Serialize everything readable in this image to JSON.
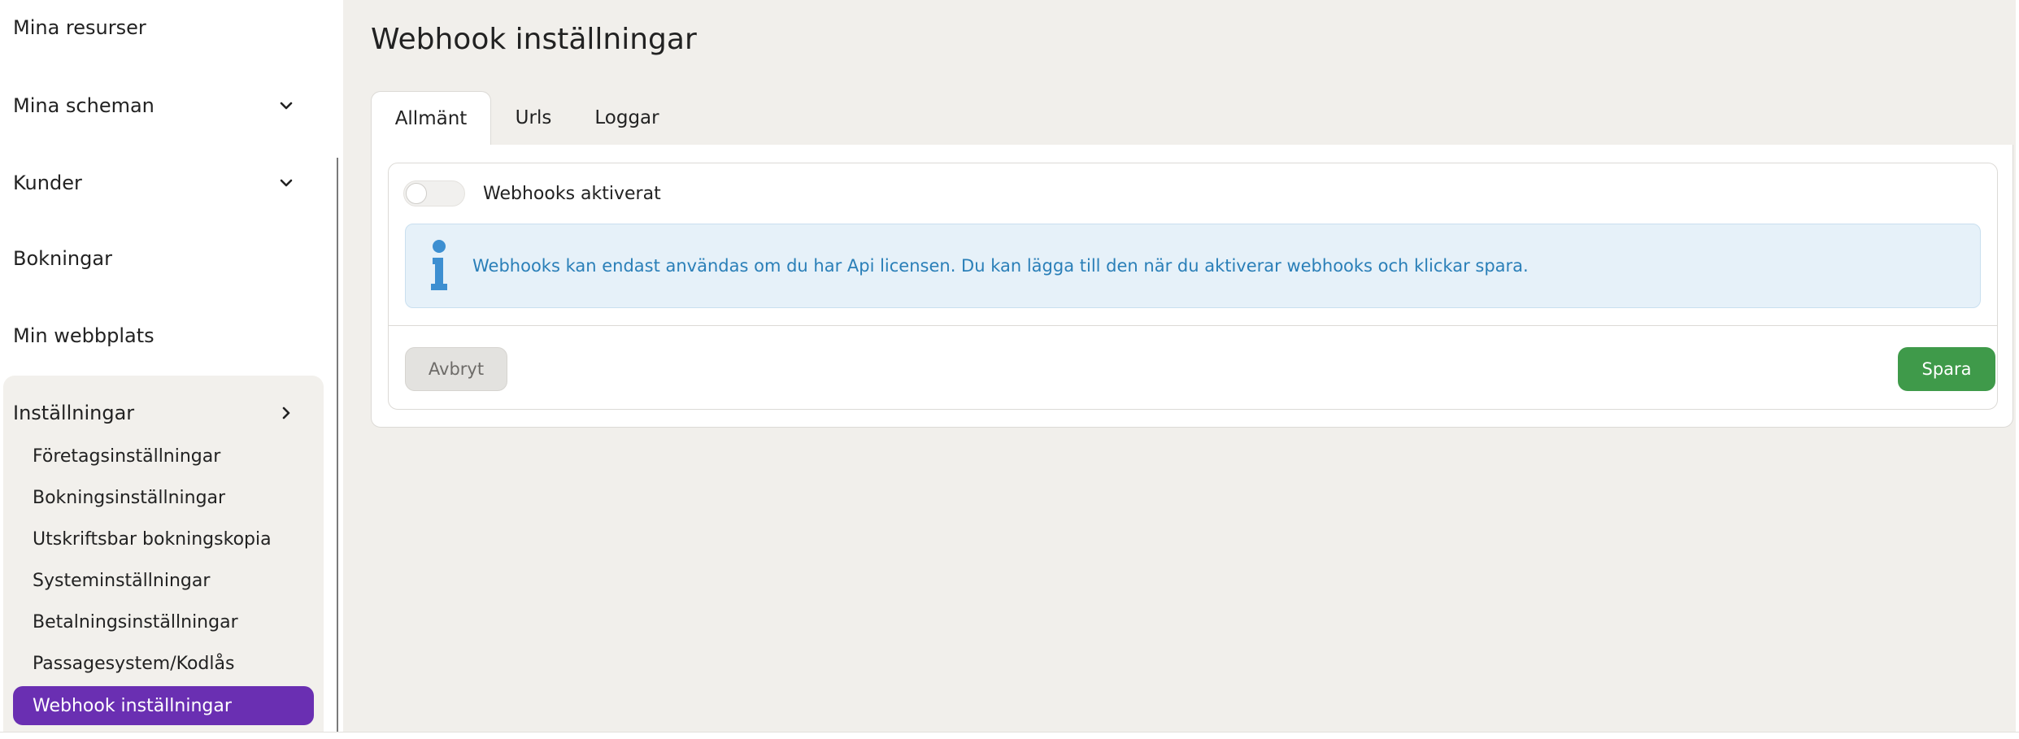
{
  "sidebar": {
    "items": [
      {
        "label": "Mina resurser",
        "chevron": null
      },
      {
        "label": "Mina scheman",
        "chevron": "chevron-down-icon"
      },
      {
        "label": "Kunder",
        "chevron": "chevron-down-icon"
      },
      {
        "label": "Bokningar",
        "chevron": null
      },
      {
        "label": "Min webbplats",
        "chevron": null
      },
      {
        "label": "Inställningar",
        "chevron": "chevron-right-icon"
      }
    ],
    "settings_sub_items": [
      "Företagsinställningar",
      "Bokningsinställningar",
      "Utskriftsbar bokningskopia",
      "Systeminställningar",
      "Betalningsinställningar",
      "Passagesystem/Kodlås",
      "Webhook inställningar"
    ],
    "active_sub_item": "Webhook inställningar"
  },
  "main": {
    "title": "Webhook inställningar",
    "tabs": [
      {
        "label": "Allmänt",
        "active": true
      },
      {
        "label": "Urls",
        "active": false
      },
      {
        "label": "Loggar",
        "active": false
      }
    ],
    "toggle": {
      "label": "Webhooks aktiverat",
      "on": false
    },
    "alert": {
      "icon": "info-icon",
      "text": "Webhooks kan endast användas om du har Api licensen. Du kan lägga till den när du aktiverar webhooks och klickar spara."
    },
    "buttons": {
      "cancel": "Avbryt",
      "save": "Spara"
    }
  },
  "colors": {
    "active_nav": "#6a2fb2",
    "save_button": "#3f9a4a",
    "info_bg": "#e6f1f9",
    "info_text": "#2a7fb8",
    "page_bg": "#f1efeb"
  }
}
